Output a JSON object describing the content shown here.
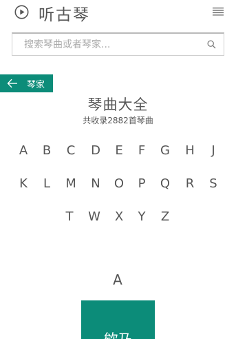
{
  "header": {
    "title": "听古琴",
    "play_icon": "play-circle-icon",
    "menu_icon": "hamburger-menu-icon"
  },
  "search": {
    "placeholder": "搜索琴曲或者琴家...",
    "value": "",
    "icon": "search-icon"
  },
  "back_button": {
    "label": "琴家",
    "icon": "arrow-left-icon"
  },
  "main": {
    "title": "琴曲大全",
    "subtitle": "共收录2882首琴曲",
    "index_letters": [
      [
        "A",
        "B",
        "C",
        "D",
        "E",
        "F",
        "G",
        "H",
        "J"
      ],
      [
        "K",
        "L",
        "M",
        "N",
        "O",
        "P",
        "Q",
        "R",
        "S"
      ],
      [
        "T",
        "W",
        "X",
        "Y",
        "Z"
      ]
    ],
    "section_letter": "A",
    "first_tile_label": "欸乃"
  },
  "colors": {
    "accent": "#0c8c79",
    "text": "#555555",
    "border": "#cfcfcf"
  }
}
